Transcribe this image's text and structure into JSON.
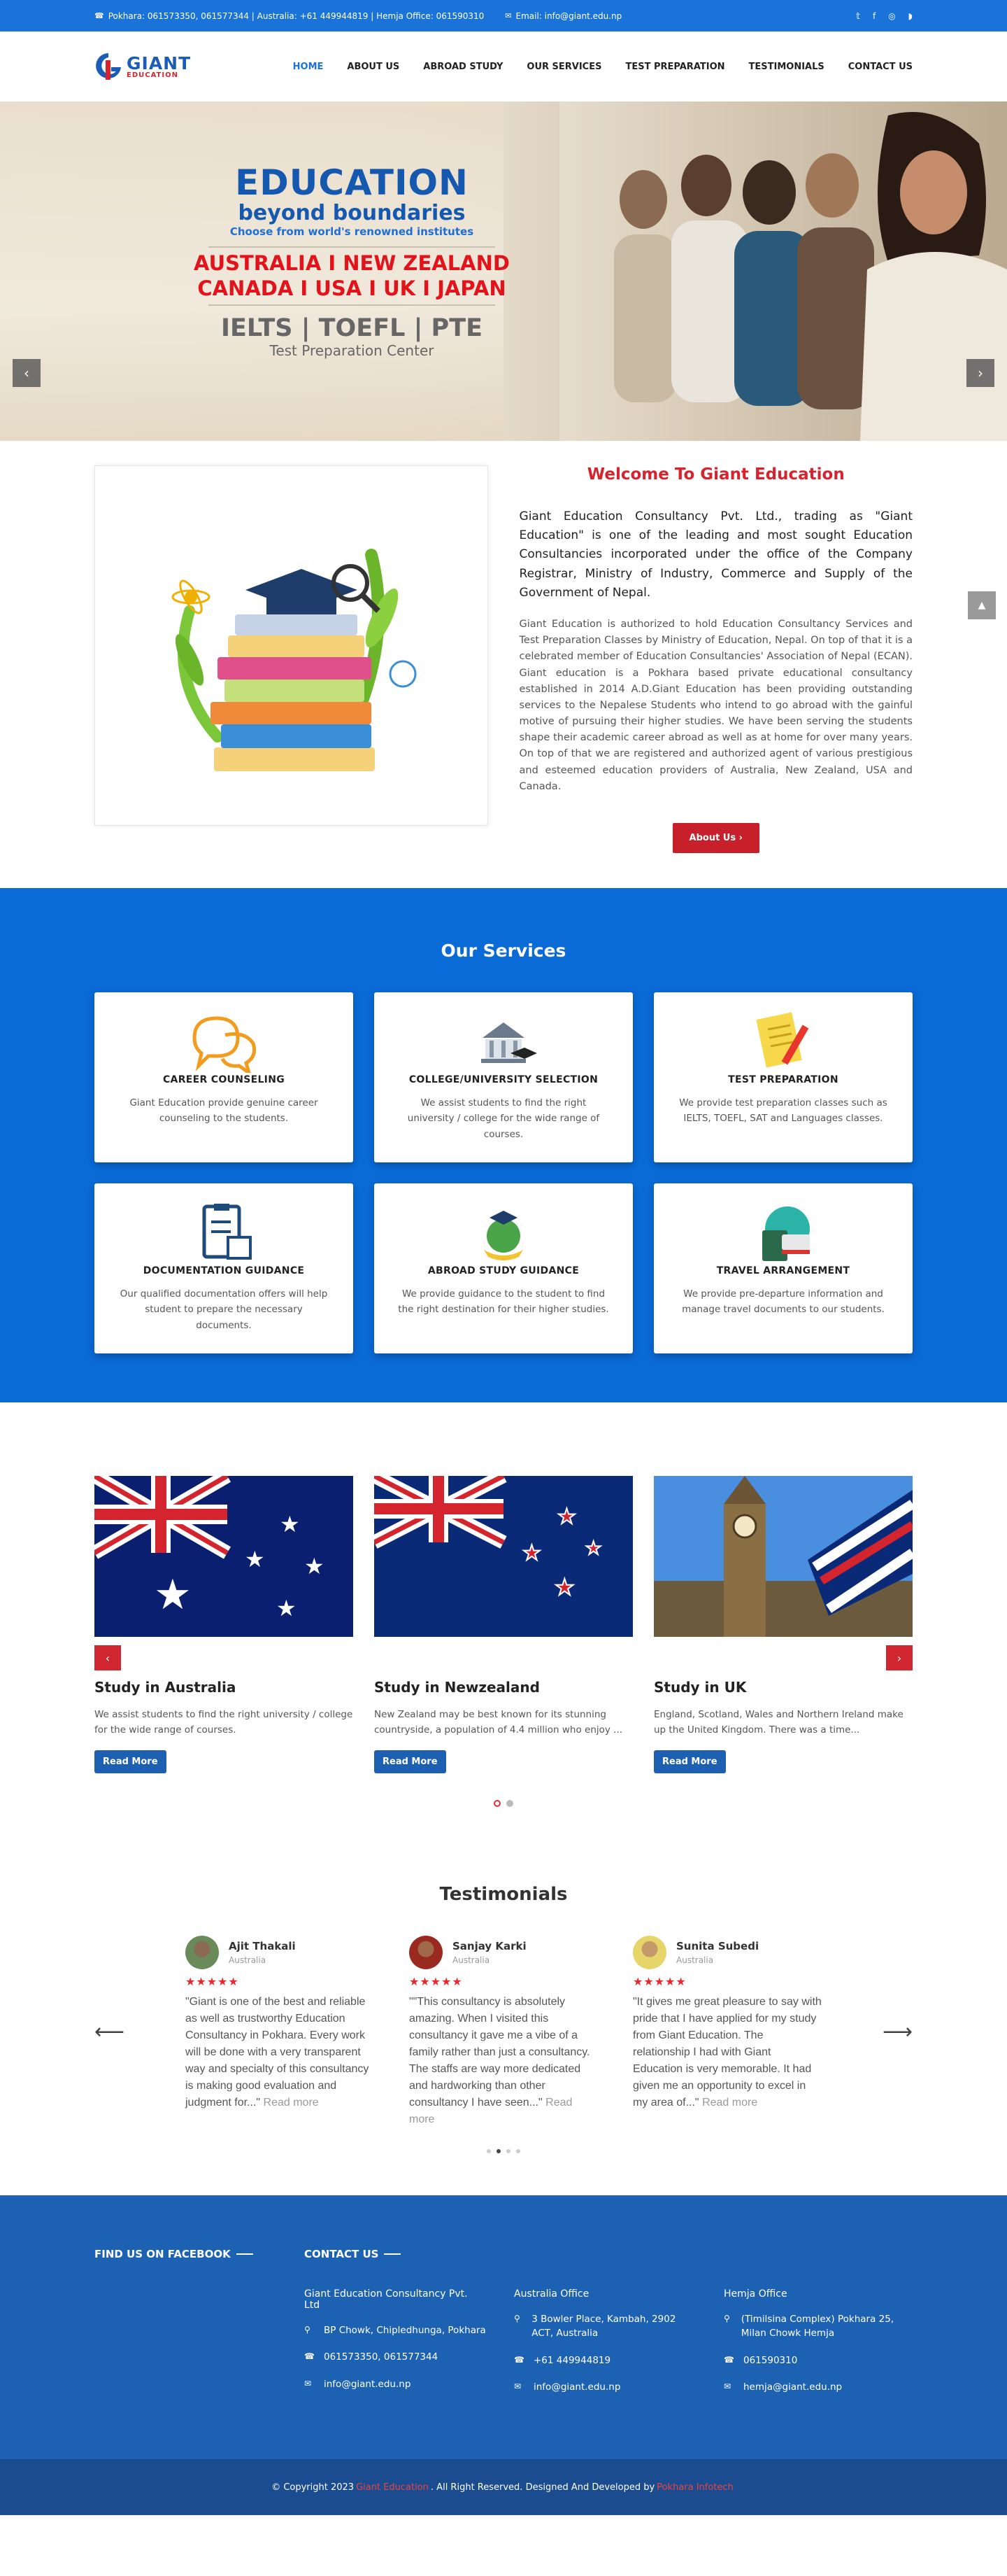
{
  "topbar": {
    "contact": "Pokhara: 061573350, 061577344 | Australia: +61 449944819 | Hemja Office: 061590310",
    "email": "Email: info@giant.edu.np",
    "social": [
      "twitter-icon",
      "facebook-icon",
      "instagram-icon",
      "rss-icon"
    ]
  },
  "logo": {
    "name": "GIANT",
    "sub": "EDUCATION"
  },
  "nav": [
    {
      "label": "HOME",
      "active": true
    },
    {
      "label": "ABOUT US"
    },
    {
      "label": "ABROAD STUDY"
    },
    {
      "label": "OUR SERVICES"
    },
    {
      "label": "TEST PREPARATION"
    },
    {
      "label": "TESTIMONIALS"
    },
    {
      "label": "CONTACT US"
    }
  ],
  "hero": {
    "line1": "EDUCATION",
    "line2": "beyond boundaries",
    "line3": "Choose from world's renowned institutes",
    "line4": "AUSTRALIA I NEW ZEALAND",
    "line5": "CANADA I USA I UK I JAPAN",
    "line6": "IELTS | TOEFL | PTE",
    "line7": "Test Preparation Center"
  },
  "welcome": {
    "title": "Welcome To Giant Education",
    "lead": "Giant Education Consultancy Pvt. Ltd., trading as \"Giant Education\" is one of the leading and most sought Education Consultancies incorporated under the office of the Company Registrar, Ministry of Industry, Commerce and Supply of the Government of Nepal.",
    "para": "Giant Education is authorized to hold Education Consultancy Services and Test Preparation Classes by Ministry of Education, Nepal. On top of that it is a celebrated member of Education Consultancies' Association of Nepal (ECAN). Giant education is a Pokhara based private educational consultancy established in 2014 A.D.Giant Education has been providing outstanding services to the Nepalese Students who intend to go abroad with the gainful motive of pursuing their higher studies. We have been serving the students shape their academic career abroad as well as at home for over many years. On top of that we are registered and authorized agent of various prestigious and esteemed education providers of Australia, New Zealand, USA and Canada.",
    "button": "About Us ›"
  },
  "services": {
    "title": "Our Services",
    "items": [
      {
        "title": "CAREER COUNSELING",
        "text": "Giant Education provide genuine career counseling to the students."
      },
      {
        "title": "COLLEGE/UNIVERSITY SELECTION",
        "text": "We assist students to find the right university / college for the wide range of courses."
      },
      {
        "title": "TEST PREPARATION",
        "text": "We provide test preparation classes such as IELTS, TOEFL, SAT and Languages classes."
      },
      {
        "title": "DOCUMENTATION GUIDANCE",
        "text": "Our qualified documentation offers will help student to prepare the necessary documents."
      },
      {
        "title": "ABROAD STUDY GUIDANCE",
        "text": "We provide guidance to the student to find the right destination for their higher studies."
      },
      {
        "title": "TRAVEL ARRANGEMENT",
        "text": "We provide pre-departure information and manage travel documents to our students."
      }
    ]
  },
  "study": {
    "items": [
      {
        "title": "Study in Australia",
        "text": "We assist students to find the right university / college for the wide range of courses.",
        "button": "Read More"
      },
      {
        "title": "Study in Newzealand",
        "text": "New Zealand may be best known for its stunning countryside, a population of 4.4 million who enjoy ...",
        "button": "Read More"
      },
      {
        "title": "Study in UK",
        "text": "England, Scotland, Wales and Northern Ireland make up the United Kingdom. There was a time...",
        "button": "Read More"
      }
    ]
  },
  "testimonials": {
    "title": "Testimonials",
    "items": [
      {
        "name": "Ajit Thakali",
        "loc": "Australia",
        "stars": "★★★★★",
        "quote": "\"Giant is one of the best and reliable as well as trustworthy Education Consultancy in Pokhara. Every work will be done with a very transparent way and specialty of this consultancy is making good evaluation and judgment for...\"",
        "more": "Read more"
      },
      {
        "name": "Sanjay Karki",
        "loc": "Australia",
        "stars": "★★★★★",
        "quote": "\"\"This consultancy is absolutely amazing. When I visited this consultancy it gave me a vibe of a family rather than just a consultancy. The staffs are way more dedicated and hardworking than other consultancy I have seen...\"",
        "more": "Read more"
      },
      {
        "name": "Sunita Subedi",
        "loc": "Australia",
        "stars": "★★★★★",
        "quote": "\"It gives me great pleasure to say with pride that I have applied for my study from Giant Education. The relationship I had with Giant Education is very memorable. It had given me an opportunity to excel in my area of...\"",
        "more": "Read more"
      }
    ]
  },
  "footer": {
    "fb_title": "FIND US ON FACEBOOK",
    "contact_title": "CONTACT US",
    "office1": {
      "title": "Giant Education Consultancy Pvt. Ltd",
      "addr": "BP Chowk, Chipledhunga, Pokhara",
      "phone": "061573350, 061577344",
      "email": "info@giant.edu.np"
    },
    "office2": {
      "title": "Australia Office",
      "addr": "3 Bowler Place, Kambah, 2902 ACT, Australia",
      "phone": "+61 449944819",
      "email": "info@giant.edu.np"
    },
    "office3": {
      "title": "Hemja Office",
      "addr": "(Timilsina Complex) Pokhara 25, Milan Chowk Hemja",
      "phone": "061590310",
      "email": "hemja@giant.edu.np"
    }
  },
  "copyright": {
    "pre": "© Copyright 2023",
    "brand": "Giant Education",
    "mid": ". All Right Reserved.  Designed And Developed by",
    "dev": "Pokhara Infotech"
  }
}
